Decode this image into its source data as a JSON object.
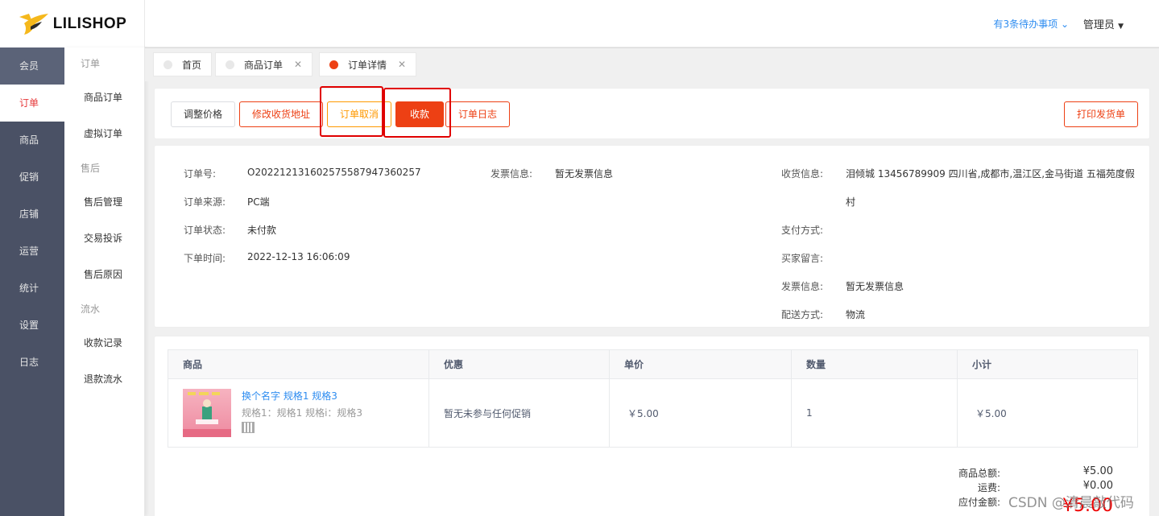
{
  "app": {
    "logo_text": "LILISHOP",
    "accent": "#ed4014"
  },
  "header": {
    "todo": "有3条待办事项",
    "admin": "管理员"
  },
  "nav": {
    "items": [
      {
        "label": "会员"
      },
      {
        "label": "订单"
      },
      {
        "label": "商品"
      },
      {
        "label": "促销"
      },
      {
        "label": "店铺"
      },
      {
        "label": "运营"
      },
      {
        "label": "统计"
      },
      {
        "label": "设置"
      },
      {
        "label": "日志"
      }
    ]
  },
  "subnav": {
    "group_order": "订单",
    "goods_order": "商品订单",
    "virtual_order": "虚拟订单",
    "group_after": "售后",
    "after_manage": "售后管理",
    "complaint": "交易投诉",
    "after_reason": "售后原因",
    "group_flow": "流水",
    "payment_log": "收款记录",
    "refund_flow": "退款流水"
  },
  "tabs": [
    {
      "label": "首页"
    },
    {
      "label": "商品订单"
    },
    {
      "label": "订单详情"
    }
  ],
  "actions": {
    "adjust_price": "调整价格",
    "modify_address": "修改收货地址",
    "cancel_order": "订单取消",
    "collect": "收款",
    "order_log": "订单日志",
    "print_ship": "打印发货单"
  },
  "order": {
    "order_no_label": "订单号:",
    "order_no": "O202212131602575587947360257",
    "source_label": "订单来源:",
    "source": "PC端",
    "status_label": "订单状态:",
    "status": "未付款",
    "time_label": "下单时间:",
    "time": "2022-12-13 16:06:09",
    "invoice_label": "发票信息:",
    "invoice": "暂无发票信息",
    "receive_label": "收货信息:",
    "receive_line1": "泪倾城 13456789909 四川省,成都市,温江区,金马街道 五福苑度假",
    "receive_line2": "村",
    "pay_label": "支付方式:",
    "remark_label": "买家留言:",
    "invoice2_label": "发票信息:",
    "invoice2": "暂无发票信息",
    "ship_label": "配送方式:",
    "ship": "物流"
  },
  "table": {
    "headers": [
      "商品",
      "优惠",
      "单价",
      "数量",
      "小计"
    ],
    "rows": [
      {
        "name": "换个名字 规格1 规格3",
        "spec": "规格1：规格1 规格i：规格3",
        "promo": "暂无未参与任何促销",
        "price": "￥5.00",
        "qty": "1",
        "subtotal": "￥5.00"
      }
    ]
  },
  "summary": {
    "goods_total_label": "商品总额:",
    "goods_total": "¥5.00",
    "freight_label": "运费:",
    "freight": "¥0.00",
    "pay_amount_label": "应付金额:",
    "pay_amount": "¥5.00"
  },
  "watermark": "CSDN @清晨敲代码"
}
